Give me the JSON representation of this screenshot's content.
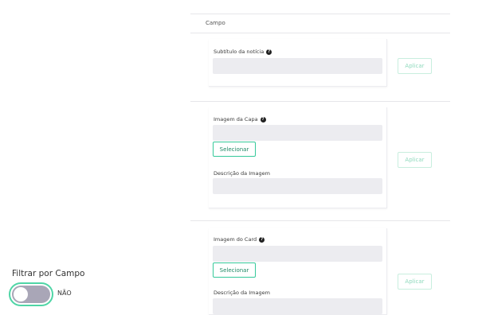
{
  "table": {
    "column_header": "Campo"
  },
  "rows": [
    {
      "fields": [
        {
          "label": "Subtítulo da notícia",
          "help_icon": "question-circle-icon",
          "value": ""
        }
      ],
      "apply_label": "Aplicar"
    },
    {
      "fields": [
        {
          "label": "Imagem da Capa",
          "help_icon": "question-circle-icon",
          "value": ""
        },
        {
          "label": "Descrição da Imagem",
          "value": ""
        }
      ],
      "select_label": "Selecionar",
      "apply_label": "Aplicar"
    },
    {
      "fields": [
        {
          "label": "Imagem do Card",
          "help_icon": "question-circle-icon",
          "value": ""
        },
        {
          "label": "Descrição da Imagem",
          "value": ""
        }
      ],
      "select_label": "Selecionar",
      "apply_label": "Aplicar"
    }
  ],
  "filter": {
    "title": "Filtrar por Campo",
    "toggle_state": "NÃO",
    "toggle_on": false
  },
  "colors": {
    "accent": "#35c99a",
    "toggle_off": "#a9a6b7",
    "input_bg": "#ececf0"
  }
}
